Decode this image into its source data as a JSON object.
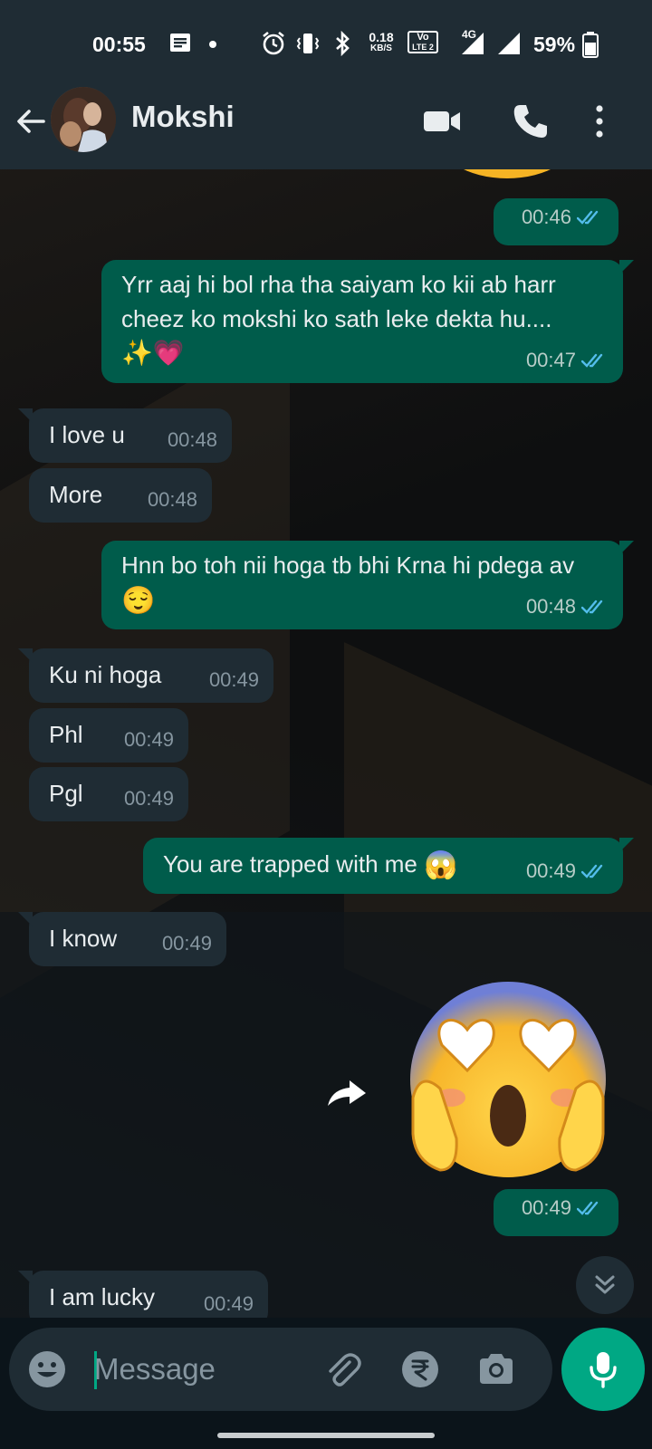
{
  "status_bar": {
    "time": "00:55",
    "net_speed_top": "0.18",
    "net_speed_bottom": "KB/S",
    "volte_top": "Vo",
    "volte_bottom": "LTE 2",
    "network": "4G",
    "battery": "59%"
  },
  "header": {
    "contact_name": "Mokshi"
  },
  "messages": [
    {
      "dir": "out",
      "text": "",
      "time": "00:46"
    },
    {
      "dir": "out",
      "text": "Yrr aaj hi bol rha tha saiyam ko kii ab harr cheez ko mokshi ko sath leke dekta hu....",
      "emoji": "✨💗",
      "time": "00:47"
    },
    {
      "dir": "in",
      "text": "I love u",
      "time": "00:48"
    },
    {
      "dir": "in",
      "text": "More",
      "time": "00:48"
    },
    {
      "dir": "out",
      "text": "Hnn bo toh nii hoga tb bhi Krna hi pdega av",
      "emoji": "😌",
      "time": "00:48"
    },
    {
      "dir": "in",
      "text": "Ku ni hoga",
      "time": "00:49"
    },
    {
      "dir": "in",
      "text": "Phl",
      "time": "00:49"
    },
    {
      "dir": "in",
      "text": "Pgl",
      "time": "00:49"
    },
    {
      "dir": "out",
      "text": "You are trapped with me",
      "emoji": "😱",
      "time": "00:49"
    },
    {
      "dir": "in",
      "text": "I know",
      "time": "00:49"
    },
    {
      "dir": "out",
      "text": "",
      "time": "00:49"
    },
    {
      "dir": "in",
      "text": "I am lucky",
      "time": "00:49"
    }
  ],
  "composer": {
    "placeholder": "Message"
  },
  "icons": {
    "back": "arrow-left-icon",
    "video": "video-camera-icon",
    "call": "phone-icon",
    "menu": "more-vert-icon",
    "emoji": "emoji-icon",
    "attach": "paperclip-icon",
    "payment": "rupee-icon",
    "camera": "camera-icon",
    "mic": "microphone-icon",
    "forward": "forward-icon",
    "scroll": "double-chevron-down-icon"
  },
  "colors": {
    "outgoing_bubble": "#005c4b",
    "incoming_bubble": "#1f2c34",
    "accent": "#00a884",
    "read_tick": "#53bdeb"
  }
}
